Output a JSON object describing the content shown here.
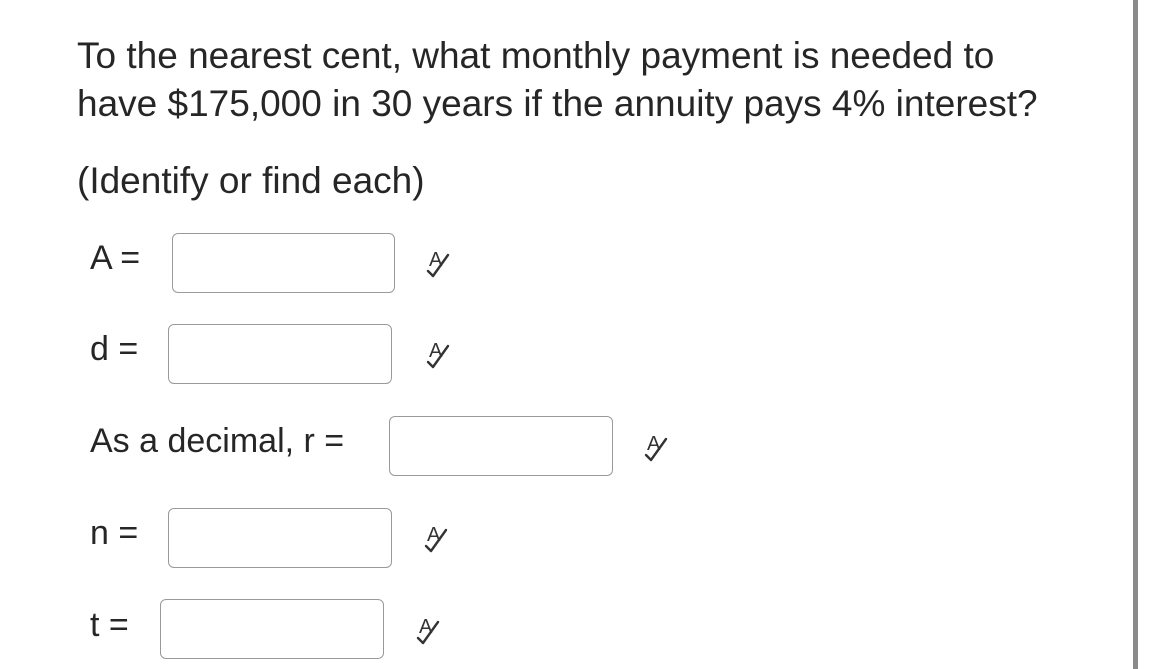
{
  "question": {
    "line1": "To the nearest cent, what monthly payment is needed to",
    "line2": "have $175,000 in 30 years if the annuity pays 4% interest?"
  },
  "instruction": "(Identify or find each)",
  "fields": {
    "A": {
      "label": "A =",
      "value": "",
      "icon": "spellcheck-icon"
    },
    "d": {
      "label": "d =",
      "value": "",
      "icon": "spellcheck-icon"
    },
    "r": {
      "label": "As a decimal, r =",
      "value": "",
      "icon": "spellcheck-icon"
    },
    "n": {
      "label": "n =",
      "value": "",
      "icon": "spellcheck-icon"
    },
    "t": {
      "label": "t =",
      "value": "",
      "icon": "spellcheck-icon"
    }
  },
  "colors": {
    "text": "#262626",
    "box_border": "#9a9a9a",
    "right_rule": "#8a8a8a"
  }
}
